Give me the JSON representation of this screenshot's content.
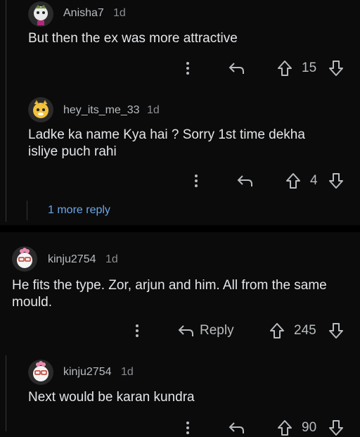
{
  "comments": [
    {
      "username": "Anisha7",
      "age": "1d",
      "text": "But then the ex was more attractive",
      "votes": "15"
    },
    {
      "username": "hey_its_me_33",
      "age": "1d",
      "text_line1": "Ladke ka name Kya hai ?  Sorry 1st time dekha",
      "text_line2": "isliye puch rahi",
      "votes": "4"
    },
    {
      "username": "kinju2754",
      "age": "1d",
      "text_line1": "He fits the type. Zor, arjun and him. All from the same",
      "text_line2": "mould.",
      "reply_label": "Reply",
      "votes": "245"
    },
    {
      "username": "kinju2754",
      "age": "1d",
      "text": "Next would be karan kundra",
      "votes": "90"
    }
  ],
  "more_replies": "1 more reply",
  "colors": {
    "background": "#0b0b0c",
    "text": "#e4e6e8",
    "link": "#6aa8e8",
    "separator": "#000000"
  },
  "icons": [
    "more-vertical-icon",
    "reply-arrow-icon",
    "upvote-icon",
    "downvote-icon"
  ]
}
